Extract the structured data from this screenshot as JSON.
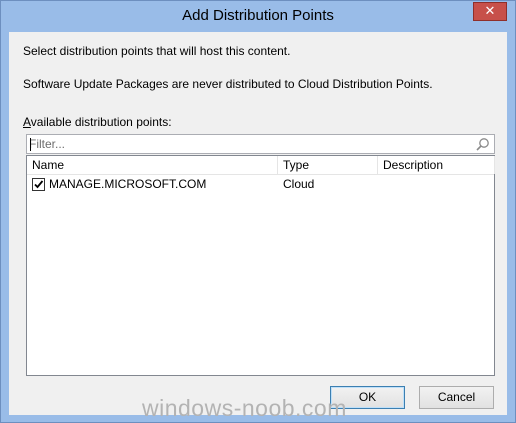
{
  "window": {
    "title": "Add Distribution Points",
    "close_glyph": "✕"
  },
  "messages": {
    "line1": "Select distribution points that will host this content.",
    "line2": "Software Update Packages are never distributed to Cloud Distribution Points."
  },
  "filter": {
    "label_accel": "A",
    "label_rest": "vailable distribution points:",
    "placeholder": "Filter...",
    "value": "",
    "icon": "search-icon"
  },
  "list": {
    "columns": [
      "Name",
      "Type",
      "Description"
    ],
    "rows": [
      {
        "checked": true,
        "name": "MANAGE.MICROSOFT.COM",
        "type": "Cloud",
        "description": ""
      }
    ]
  },
  "buttons": {
    "ok": "OK",
    "cancel": "Cancel"
  },
  "watermark": "windows-noob.com"
}
